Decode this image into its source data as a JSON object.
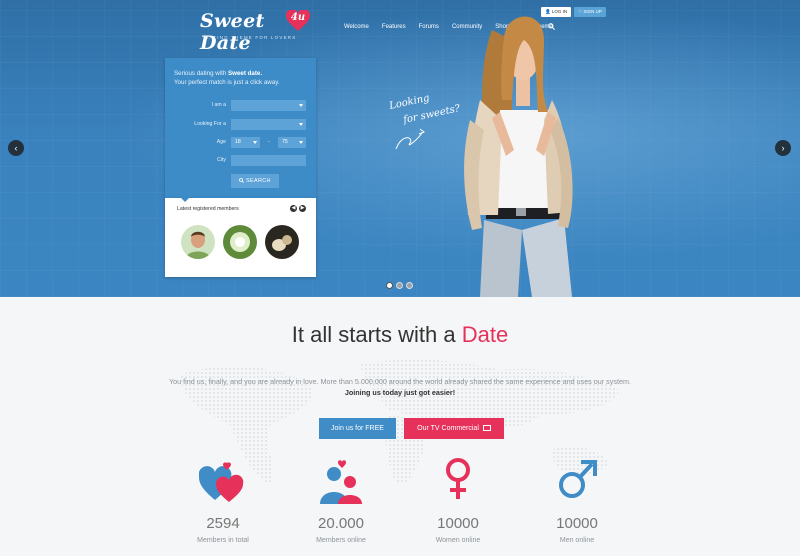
{
  "brand": {
    "name": "Sweet Date",
    "badge": "4u",
    "tagline": "DATING THEME FOR LOVERS"
  },
  "nav": {
    "items": [
      "Welcome",
      "Features",
      "Forums",
      "Community",
      "Shop",
      "Buy Theme"
    ],
    "search_icon": "search-icon"
  },
  "auth": {
    "login": "LOG IN",
    "signup": "SIGN UP"
  },
  "slider": {
    "prev_icon": "chevron-left-icon",
    "next_icon": "chevron-right-icon",
    "dots": 3,
    "active_dot": 0
  },
  "hero": {
    "handwriting_line1": "Looking",
    "handwriting_line2": "for sweets?"
  },
  "search_form": {
    "intro_prefix": "Serious dating with ",
    "intro_brand": "Sweet date.",
    "intro_line2": "Your perfect match is just a click away.",
    "i_am_label": "I am a",
    "i_am_value": "",
    "looking_for_label": "Looking For a",
    "looking_for_value": "",
    "age_label": "Age",
    "age_from": "18",
    "age_to": "75",
    "age_separator": "-",
    "city_label": "City",
    "city_value": "",
    "search_button": "SEARCH"
  },
  "members": {
    "title": "Latest registered members"
  },
  "main": {
    "headline_prefix": "It all starts with a ",
    "headline_accent": "Date",
    "desc_text": "You find us, finally, and you are already in love. More than 5.000.000 around the world already shared the same experience and uses our system.",
    "desc_bold": "Joining us today just got easier!",
    "join_button": "Join us for FREE",
    "tv_button": "Our TV Commercial"
  },
  "stats": [
    {
      "value": "2594",
      "label": "Members in total",
      "icon": "hearts-icon"
    },
    {
      "value": "20.000",
      "label": "Members online",
      "icon": "couple-icon"
    },
    {
      "value": "10000",
      "label": "Women online",
      "icon": "female-symbol-icon"
    },
    {
      "value": "10000",
      "label": "Men online",
      "icon": "male-symbol-icon"
    }
  ],
  "colors": {
    "accent_blue": "#3f8cc6",
    "accent_pink": "#e6325a",
    "hero_blue": "#3a82bd"
  }
}
